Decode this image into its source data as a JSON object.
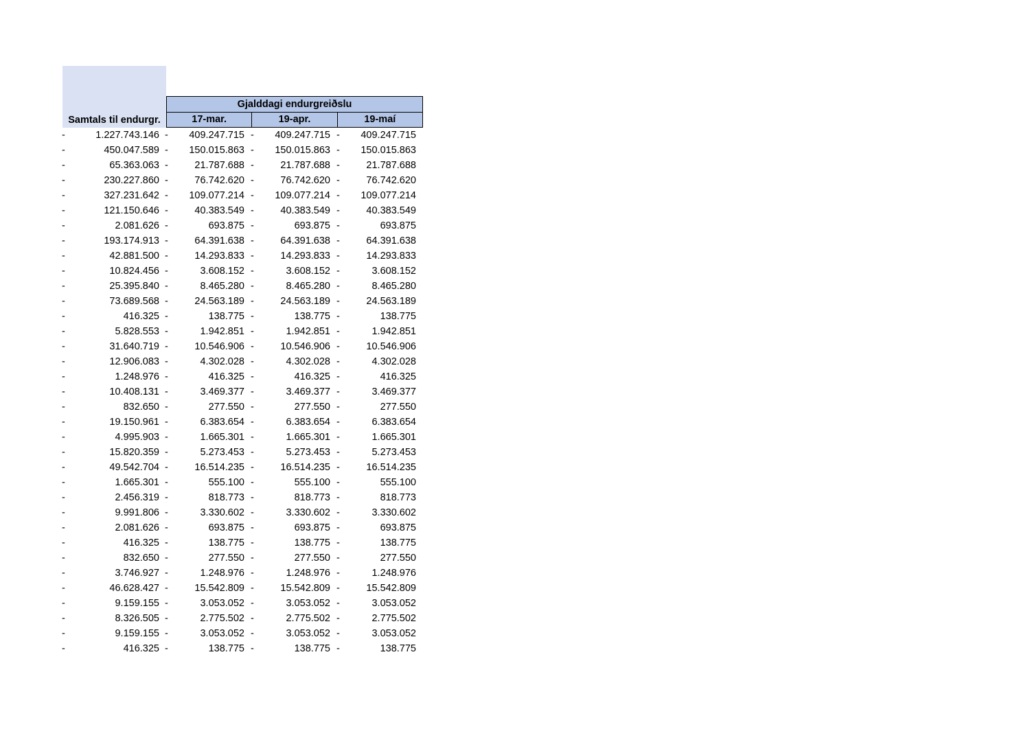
{
  "header": {
    "column_title": "Samtals til endurgr.",
    "group_title": "Gjalddagi endurgreiðslu",
    "dates": [
      "17-mar.",
      "19-apr.",
      "19-maí"
    ]
  },
  "marker": "-",
  "rows": [
    [
      "1.227.743.146",
      "409.247.715",
      "409.247.715",
      "409.247.715"
    ],
    [
      "450.047.589",
      "150.015.863",
      "150.015.863",
      "150.015.863"
    ],
    [
      "65.363.063",
      "21.787.688",
      "21.787.688",
      "21.787.688"
    ],
    [
      "230.227.860",
      "76.742.620",
      "76.742.620",
      "76.742.620"
    ],
    [
      "327.231.642",
      "109.077.214",
      "109.077.214",
      "109.077.214"
    ],
    [
      "121.150.646",
      "40.383.549",
      "40.383.549",
      "40.383.549"
    ],
    [
      "2.081.626",
      "693.875",
      "693.875",
      "693.875"
    ],
    [
      "193.174.913",
      "64.391.638",
      "64.391.638",
      "64.391.638"
    ],
    [
      "42.881.500",
      "14.293.833",
      "14.293.833",
      "14.293.833"
    ],
    [
      "10.824.456",
      "3.608.152",
      "3.608.152",
      "3.608.152"
    ],
    [
      "25.395.840",
      "8.465.280",
      "8.465.280",
      "8.465.280"
    ],
    [
      "73.689.568",
      "24.563.189",
      "24.563.189",
      "24.563.189"
    ],
    [
      "416.325",
      "138.775",
      "138.775",
      "138.775"
    ],
    [
      "5.828.553",
      "1.942.851",
      "1.942.851",
      "1.942.851"
    ],
    [
      "31.640.719",
      "10.546.906",
      "10.546.906",
      "10.546.906"
    ],
    [
      "12.906.083",
      "4.302.028",
      "4.302.028",
      "4.302.028"
    ],
    [
      "1.248.976",
      "416.325",
      "416.325",
      "416.325"
    ],
    [
      "10.408.131",
      "3.469.377",
      "3.469.377",
      "3.469.377"
    ],
    [
      "832.650",
      "277.550",
      "277.550",
      "277.550"
    ],
    [
      "19.150.961",
      "6.383.654",
      "6.383.654",
      "6.383.654"
    ],
    [
      "4.995.903",
      "1.665.301",
      "1.665.301",
      "1.665.301"
    ],
    [
      "15.820.359",
      "5.273.453",
      "5.273.453",
      "5.273.453"
    ],
    [
      "49.542.704",
      "16.514.235",
      "16.514.235",
      "16.514.235"
    ],
    [
      "1.665.301",
      "555.100",
      "555.100",
      "555.100"
    ],
    [
      "2.456.319",
      "818.773",
      "818.773",
      "818.773"
    ],
    [
      "9.991.806",
      "3.330.602",
      "3.330.602",
      "3.330.602"
    ],
    [
      "2.081.626",
      "693.875",
      "693.875",
      "693.875"
    ],
    [
      "416.325",
      "138.775",
      "138.775",
      "138.775"
    ],
    [
      "832.650",
      "277.550",
      "277.550",
      "277.550"
    ],
    [
      "3.746.927",
      "1.248.976",
      "1.248.976",
      "1.248.976"
    ],
    [
      "46.628.427",
      "15.542.809",
      "15.542.809",
      "15.542.809"
    ],
    [
      "9.159.155",
      "3.053.052",
      "3.053.052",
      "3.053.052"
    ],
    [
      "8.326.505",
      "2.775.502",
      "2.775.502",
      "2.775.502"
    ],
    [
      "9.159.155",
      "3.053.052",
      "3.053.052",
      "3.053.052"
    ],
    [
      "416.325",
      "138.775",
      "138.775",
      "138.775"
    ]
  ]
}
